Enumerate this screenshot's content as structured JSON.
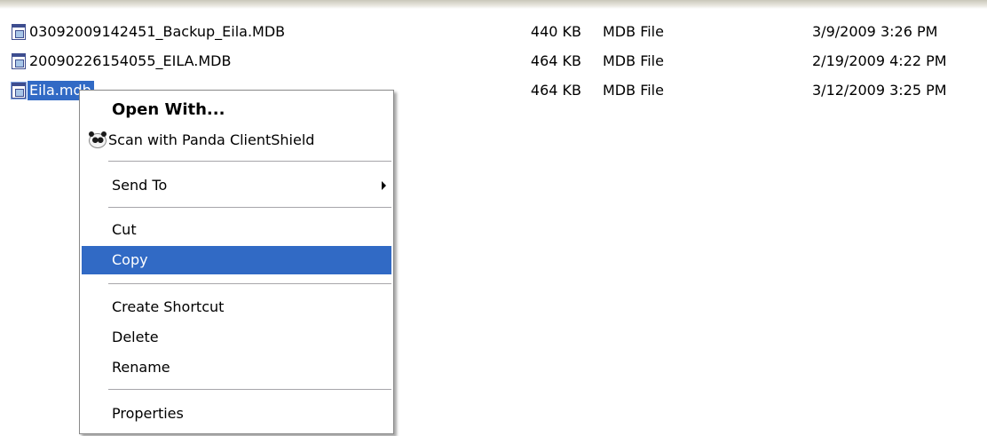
{
  "files": [
    {
      "name": "03092009142451_Backup_Eila.MDB",
      "size": "440 KB",
      "type": "MDB File",
      "modified": "3/9/2009 3:26 PM",
      "icon": "mdb-file-icon",
      "selected": false
    },
    {
      "name": "20090226154055_EILA.MDB",
      "size": "464 KB",
      "type": "MDB File",
      "modified": "2/19/2009 4:22 PM",
      "icon": "mdb-file-icon",
      "selected": false
    },
    {
      "name": "Eila.mdb",
      "size": "464 KB",
      "type": "MDB File",
      "modified": "3/12/2009 3:25 PM",
      "icon": "mdb-file-icon",
      "selected": true
    }
  ],
  "context_menu": {
    "open_with": "Open With...",
    "scan": "Scan with Panda ClientShield",
    "scan_icon": "panda-icon",
    "send_to": "Send To",
    "cut": "Cut",
    "copy": "Copy",
    "create_shortcut": "Create Shortcut",
    "delete": "Delete",
    "rename": "Rename",
    "properties": "Properties",
    "highlighted_item": "Copy"
  },
  "colors": {
    "selection": "#316ac5",
    "menu_border": "#898989",
    "separator": "#a7a6aa"
  }
}
